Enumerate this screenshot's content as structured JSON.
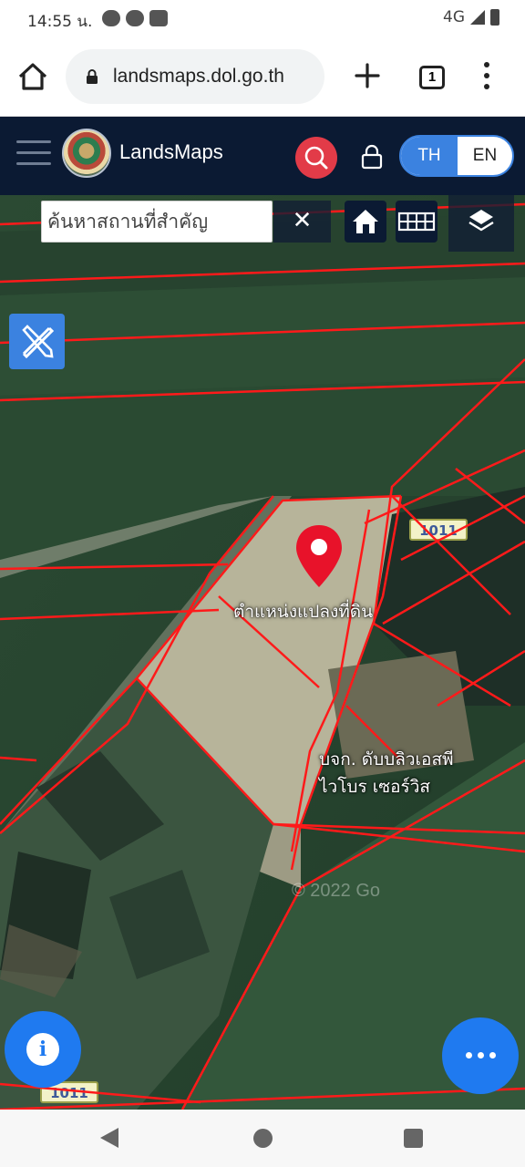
{
  "status_bar": {
    "time": "14:55 น.",
    "network": "4G"
  },
  "browser": {
    "url": "landsmaps.dol.go.th",
    "tab_count": "1"
  },
  "app": {
    "title": "LandsMaps",
    "lang_th": "TH",
    "lang_en": "EN"
  },
  "map": {
    "search_placeholder": "ค้นหาสถานที่สำคัญ",
    "clear_label": "✕",
    "road_badge": "1011",
    "road_badge_bottom": "1011",
    "parcel_label": "ตำแหน่งแปลงที่ดิน",
    "company_line1": "บจก. ดับบลิวเอสพี",
    "company_line2": "ไวโบร เซอร์วิส",
    "copyright": "© 2022 Go",
    "info_label": "i"
  },
  "colors": {
    "header_bg": "#0b1a33",
    "accent_blue": "#3b82e0",
    "search_red": "#e23b48",
    "parcel_lines": "#ff1a1a"
  }
}
